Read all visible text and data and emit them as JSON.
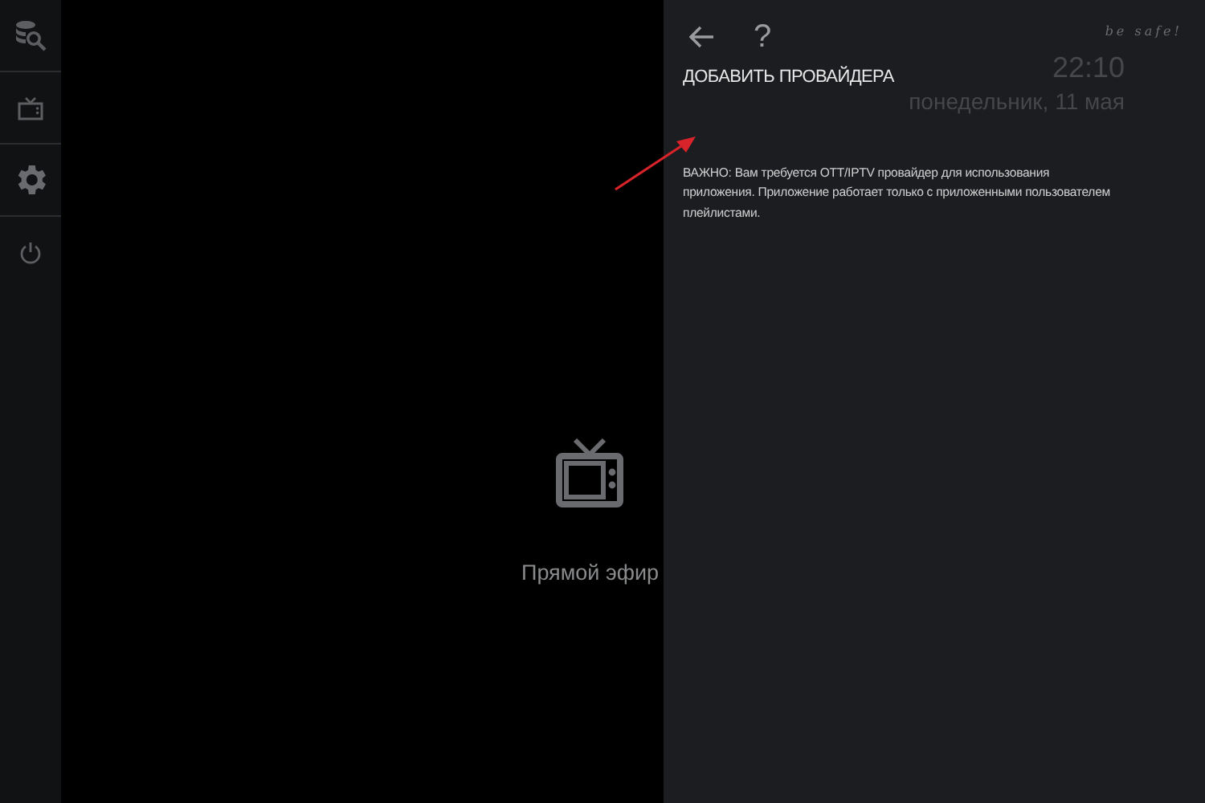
{
  "sidebar": {
    "items": [
      {
        "kind": "search"
      },
      {
        "kind": "tv"
      },
      {
        "kind": "settings"
      },
      {
        "kind": "power"
      }
    ]
  },
  "main": {
    "tile": {
      "kind": "tv",
      "label": "Прямой эфир"
    }
  },
  "panel": {
    "toolbar": [
      {
        "kind": "back"
      },
      {
        "kind": "help",
        "label": "?"
      }
    ],
    "tagline": "be safe!",
    "time": "22:10",
    "date": "понедельник, 11 мая",
    "action": "ДОБАВИТЬ ПРОВАЙДЕРА",
    "notice": "ВАЖНО: Вам требуется OTT/IPTV провайдер для использования приложения. Приложение работает только с приложенными пользователем плейлистами."
  }
}
